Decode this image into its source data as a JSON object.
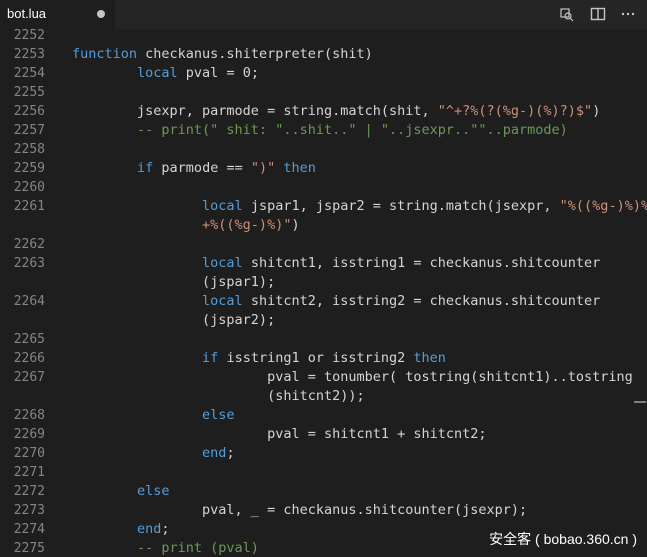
{
  "tab": {
    "title": "bot.lua",
    "modified_dot_icon": "circle-dot-icon"
  },
  "actions": [
    {
      "icon": "open-changes-icon"
    },
    {
      "icon": "split-editor-icon"
    },
    {
      "icon": "more-actions-icon"
    }
  ],
  "lines": [
    {
      "num": "2252",
      "tokens": []
    },
    {
      "num": "2253",
      "tokens": [
        {
          "t": "kw",
          "v": "function"
        },
        {
          "t": "p",
          "v": " checkanus.shiterpreter(shit)"
        }
      ]
    },
    {
      "num": "2254",
      "tokens": [
        {
          "t": "p",
          "v": "        "
        },
        {
          "t": "kw",
          "v": "local"
        },
        {
          "t": "p",
          "v": " pval = 0;"
        }
      ]
    },
    {
      "num": "2255",
      "tokens": []
    },
    {
      "num": "2256",
      "tokens": [
        {
          "t": "p",
          "v": "        jsexpr, parmode = string.match(shit, "
        },
        {
          "t": "str",
          "v": "\"^+?%(?(%g-)(%)?)$\""
        },
        {
          "t": "p",
          "v": ")"
        }
      ]
    },
    {
      "num": "2257",
      "tokens": [
        {
          "t": "cmt",
          "v": "        -- print(\" shit: \"..shit..\" | \"..jsexpr..\"\"..parmode)"
        }
      ]
    },
    {
      "num": "2258",
      "tokens": []
    },
    {
      "num": "2259",
      "tokens": [
        {
          "t": "p",
          "v": "        "
        },
        {
          "t": "kw",
          "v": "if"
        },
        {
          "t": "p",
          "v": " parmode == "
        },
        {
          "t": "str",
          "v": "\")\""
        },
        {
          "t": "p",
          "v": " "
        },
        {
          "t": "kw",
          "v": "then"
        }
      ]
    },
    {
      "num": "2260",
      "tokens": []
    },
    {
      "num": "2261",
      "tokens": [
        {
          "t": "p",
          "v": "                "
        },
        {
          "t": "kw",
          "v": "local"
        },
        {
          "t": "p",
          "v": " jspar1, jspar2 = string.match(jsexpr, "
        },
        {
          "t": "str",
          "v": "\"%((%g-)%)%"
        }
      ]
    },
    {
      "num": "",
      "tokens": [
        {
          "t": "str",
          "v": "                +%((%g-)%)\""
        },
        {
          "t": "p",
          "v": ")"
        }
      ]
    },
    {
      "num": "2262",
      "tokens": []
    },
    {
      "num": "2263",
      "tokens": [
        {
          "t": "p",
          "v": "                "
        },
        {
          "t": "kw",
          "v": "local"
        },
        {
          "t": "p",
          "v": " shitcnt1, isstring1 = checkanus.shitcounter"
        }
      ]
    },
    {
      "num": "",
      "tokens": [
        {
          "t": "p",
          "v": "                (jspar1);"
        }
      ]
    },
    {
      "num": "2264",
      "tokens": [
        {
          "t": "p",
          "v": "                "
        },
        {
          "t": "kw",
          "v": "local"
        },
        {
          "t": "p",
          "v": " shitcnt2, isstring2 = checkanus.shitcounter"
        }
      ]
    },
    {
      "num": "",
      "tokens": [
        {
          "t": "p",
          "v": "                (jspar2);"
        }
      ]
    },
    {
      "num": "2265",
      "tokens": []
    },
    {
      "num": "2266",
      "tokens": [
        {
          "t": "p",
          "v": "                "
        },
        {
          "t": "kw",
          "v": "if"
        },
        {
          "t": "p",
          "v": " isstring1 or isstring2 "
        },
        {
          "t": "kw",
          "v": "then"
        }
      ]
    },
    {
      "num": "2267",
      "tokens": [
        {
          "t": "p",
          "v": "                        pval = tonumber( tostring(shitcnt1)..tostring"
        }
      ]
    },
    {
      "num": "",
      "tokens": [
        {
          "t": "p",
          "v": "                        (shitcnt2));"
        }
      ]
    },
    {
      "num": "2268",
      "tokens": [
        {
          "t": "p",
          "v": "                "
        },
        {
          "t": "kw",
          "v": "else"
        }
      ]
    },
    {
      "num": "2269",
      "tokens": [
        {
          "t": "p",
          "v": "                        pval = shitcnt1 + shitcnt2;"
        }
      ]
    },
    {
      "num": "2270",
      "tokens": [
        {
          "t": "p",
          "v": "                "
        },
        {
          "t": "kw",
          "v": "end"
        },
        {
          "t": "p",
          "v": ";"
        }
      ]
    },
    {
      "num": "2271",
      "tokens": []
    },
    {
      "num": "2272",
      "tokens": [
        {
          "t": "p",
          "v": "        "
        },
        {
          "t": "kw",
          "v": "else"
        }
      ]
    },
    {
      "num": "2273",
      "tokens": [
        {
          "t": "p",
          "v": "                pval, _ = checkanus.shitcounter(jsexpr);"
        }
      ]
    },
    {
      "num": "2274",
      "tokens": [
        {
          "t": "p",
          "v": "        "
        },
        {
          "t": "kw",
          "v": "end"
        },
        {
          "t": "p",
          "v": ";"
        }
      ]
    },
    {
      "num": "2275",
      "tokens": [
        {
          "t": "cmt",
          "v": "        -- print (pval)"
        }
      ]
    }
  ],
  "watermark": "安全客 ( bobao.360.cn )",
  "colors": {
    "keyword": "#569cd6",
    "string": "#ce9178",
    "comment": "#6a9955",
    "text": "#d4d4d4",
    "line_number": "#858585"
  }
}
